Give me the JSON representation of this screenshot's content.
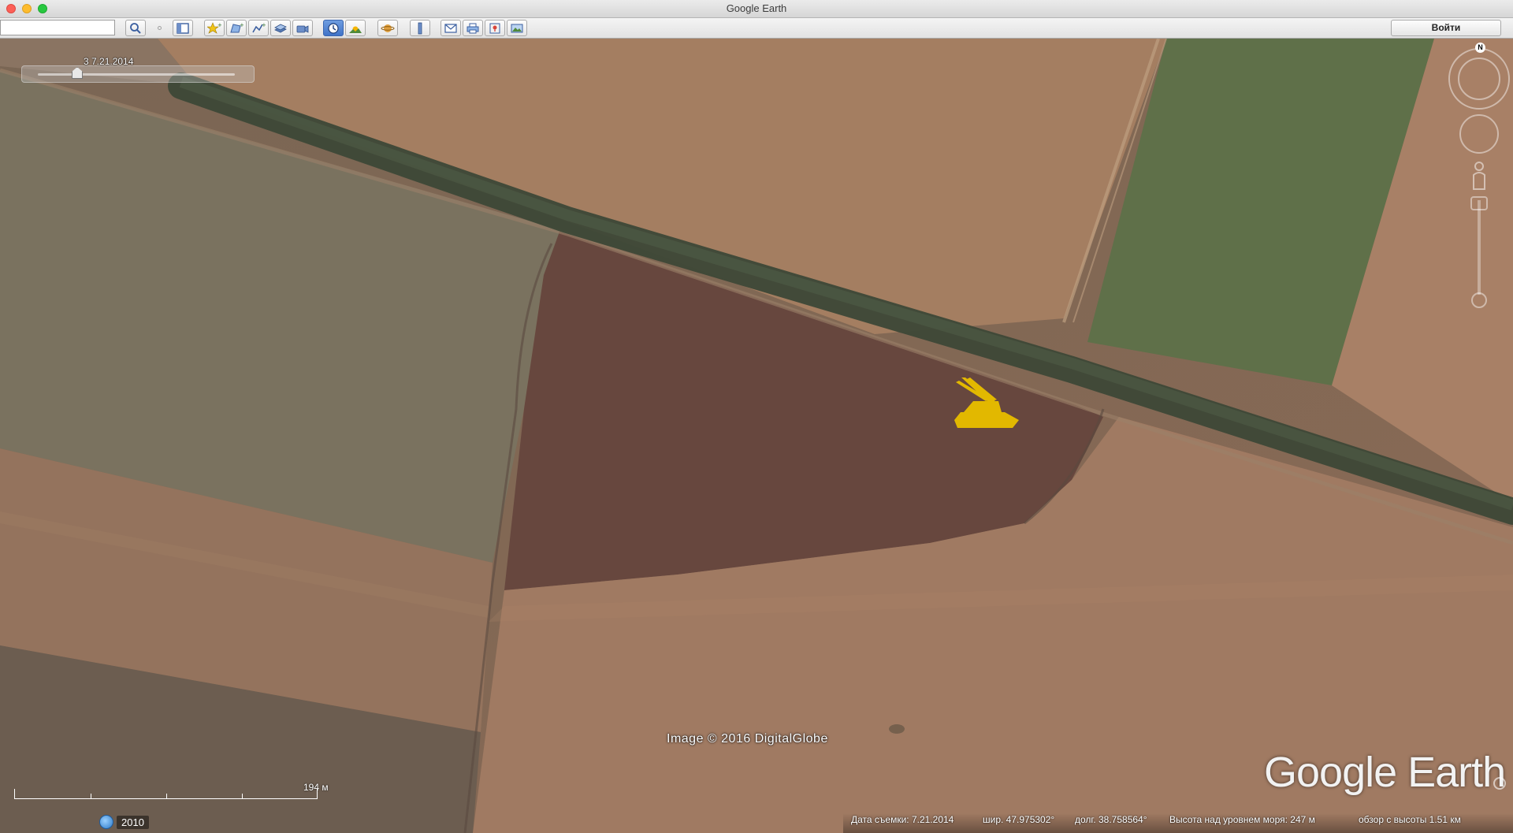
{
  "window": {
    "title": "Google Earth"
  },
  "toolbar": {
    "search_value": "",
    "signin_label": "Войти"
  },
  "icons": {
    "search": "search-icon",
    "sidebar": "sidebar-icon",
    "placemark": "add-placemark-icon",
    "polygon": "add-polygon-icon",
    "path": "add-path-icon",
    "overlay": "image-overlay-icon",
    "tour": "record-tour-icon",
    "history": "historical-imagery-icon",
    "sun": "sunlight-icon",
    "planet": "planets-icon",
    "ruler": "ruler-icon",
    "email": "email-icon",
    "print": "print-icon",
    "maps": "google-maps-icon",
    "save_image": "save-image-icon"
  },
  "time_slider": {
    "label": "3 7.21.2014",
    "position": 0.2
  },
  "compass": {
    "north_label": "N"
  },
  "attribution": "Image © 2016 DigitalGlobe",
  "logo": "Google Earth",
  "scale": {
    "label": "194 м"
  },
  "historical": {
    "year": "2010"
  },
  "status": {
    "capture_date": "Дата съемки: 7.21.2014",
    "latitude": "шир.  47.975302°",
    "longitude": "долг.  38.758564°",
    "elevation": "Высота над уровнем моря:  247 м",
    "eye_altitude": "обзор с высоты  1.51 км"
  },
  "colors": {
    "highlight": "#e2b800",
    "toolbar_active": "#4a7fd0"
  }
}
